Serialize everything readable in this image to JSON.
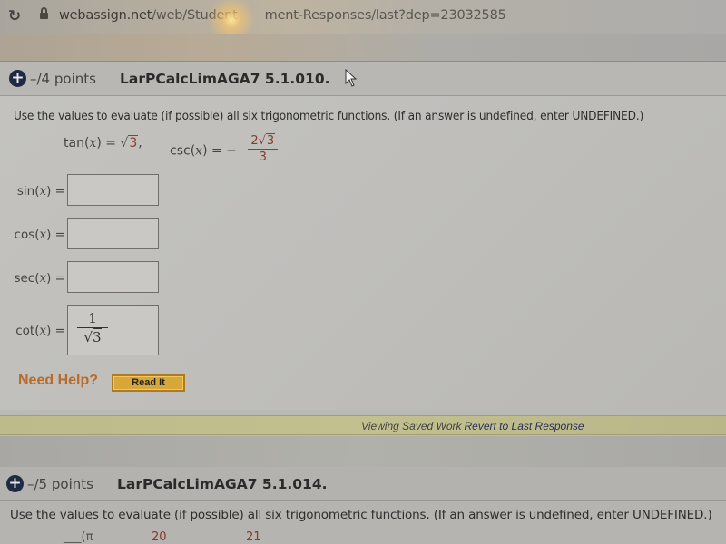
{
  "browser": {
    "url_host": "webassign.net",
    "url_path": "/web/Student/Assignment-Responses/last?dep=23032585",
    "url_path_visible_start": "/web/Student",
    "url_path_visible_end": "ment-Responses/last?dep=23032585"
  },
  "question1": {
    "points": "–/4 points",
    "id": "LarPCalcLimAGA7 5.1.010.",
    "instruction": "Use the values to evaluate (if possible) all six trigonometric functions. (If an answer is undefined, enter UNDEFINED.)",
    "given": {
      "tan_label": "tan(",
      "tan_var": "x",
      "tan_close": ") = ",
      "tan_value_radicand": "3",
      "separator": ",",
      "csc_label": "csc(",
      "csc_var": "x",
      "csc_close": ") = −",
      "csc_numerator_coef": "2",
      "csc_numerator_radicand": "3",
      "csc_denominator": "3"
    },
    "answers": [
      {
        "fn": "sin",
        "value": ""
      },
      {
        "fn": "cos",
        "value": ""
      },
      {
        "fn": "sec",
        "value": ""
      },
      {
        "fn": "cot",
        "numerator": "1",
        "denominator_radicand": "3"
      }
    ],
    "need_help_label": "Need Help?",
    "read_it_label": "Read It"
  },
  "saved_bar": {
    "status": "Viewing Saved Work",
    "revert_link": "Revert to Last Response"
  },
  "question2": {
    "points": "–/5 points",
    "id": "LarPCalcLimAGA7 5.1.014.",
    "instruction": "Use the values to evaluate (if possible) all six trigonometric functions. (If an answer is undefined, enter UNDEFINED.)",
    "partial_given": {
      "pi": "π",
      "value1": "20",
      "value2": "21"
    }
  },
  "colors": {
    "given_number": "#8a3a2a",
    "need_help": "#b86a2a",
    "read_it_bg": "#d8a73a",
    "saved_bar_bg": "#c2c08e",
    "plus_icon_bg": "#1f2a44"
  }
}
